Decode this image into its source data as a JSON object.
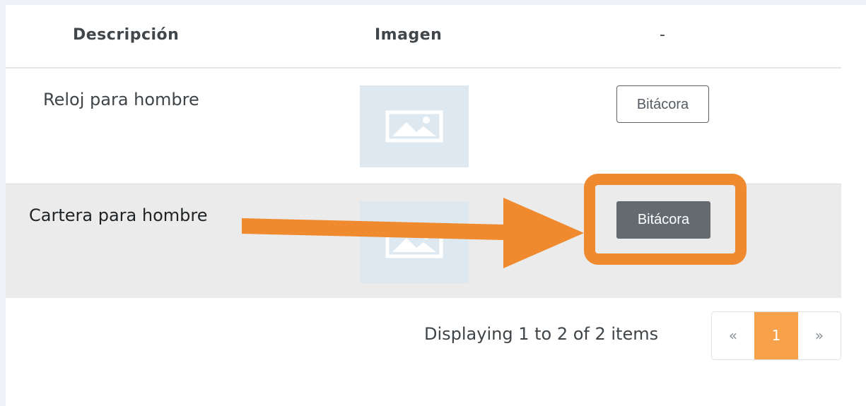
{
  "table": {
    "headers": [
      "Descripción",
      "Imagen",
      "-"
    ],
    "rows": [
      {
        "description": "Reloj para hombre",
        "image": "image-placeholder-icon",
        "action_label": "Bitácora"
      },
      {
        "description": "Cartera para hombre",
        "image": "image-placeholder-icon",
        "action_label": "Bitácora"
      }
    ]
  },
  "pagination": {
    "info": "Displaying 1 to 2 of 2 items",
    "prev": "«",
    "current": "1",
    "next": "»"
  },
  "colors": {
    "accent": "#f7a14a",
    "annotation": "#f08a2e",
    "button_dark": "#636a70",
    "selected_row": "#ebebeb",
    "thumb_bg": "#dde8f0"
  }
}
